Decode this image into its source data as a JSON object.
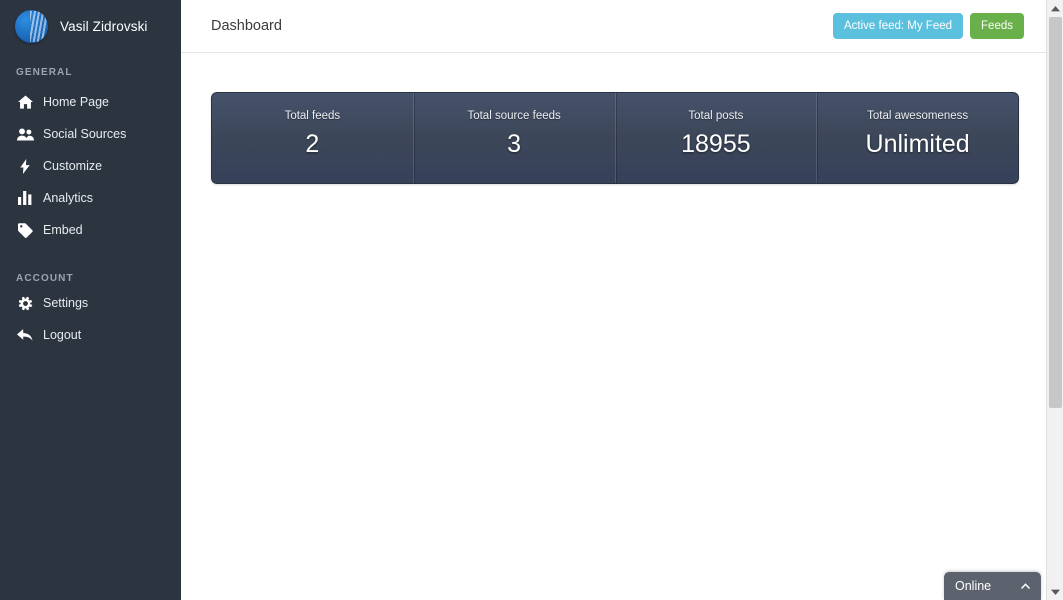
{
  "sidebar": {
    "brand": {
      "avatar_icon": "user-avatar-logo",
      "name": "Vasil Zidrovski"
    },
    "sections": [
      {
        "title": "GENERAL",
        "items": [
          {
            "label": "Home Page",
            "icon": "home-icon"
          },
          {
            "label": "Social Sources",
            "icon": "users-icon"
          },
          {
            "label": "Customize",
            "icon": "bolt-icon"
          },
          {
            "label": "Analytics",
            "icon": "bar-chart-icon"
          },
          {
            "label": "Embed",
            "icon": "tag-icon"
          }
        ]
      },
      {
        "title": "ACCOUNT",
        "items": [
          {
            "label": "Settings",
            "icon": "gear-icon"
          },
          {
            "label": "Logout",
            "icon": "reply-arrow-icon"
          }
        ]
      }
    ]
  },
  "topbar": {
    "title": "Dashboard",
    "active_feed_button": "Active feed: My Feed",
    "feeds_button": "Feeds"
  },
  "stats": [
    {
      "label": "Total feeds",
      "value": "2"
    },
    {
      "label": "Total source feeds",
      "value": "3"
    },
    {
      "label": "Total posts",
      "value": "18955"
    },
    {
      "label": "Total awesomeness",
      "value": "Unlimited"
    }
  ],
  "chat_widget": {
    "label": "Online",
    "chevron_icon": "chevron-up-icon"
  },
  "scrollbar": {
    "up_icon": "scroll-up-arrow-icon",
    "down_icon": "scroll-down-arrow-icon"
  },
  "colors": {
    "sidebar_bg": "#2c3440",
    "panel_bg": "#3c4759",
    "info_button": "#5bc0de",
    "success_button": "#6ab04a",
    "chat_widget": "#5c636e"
  }
}
